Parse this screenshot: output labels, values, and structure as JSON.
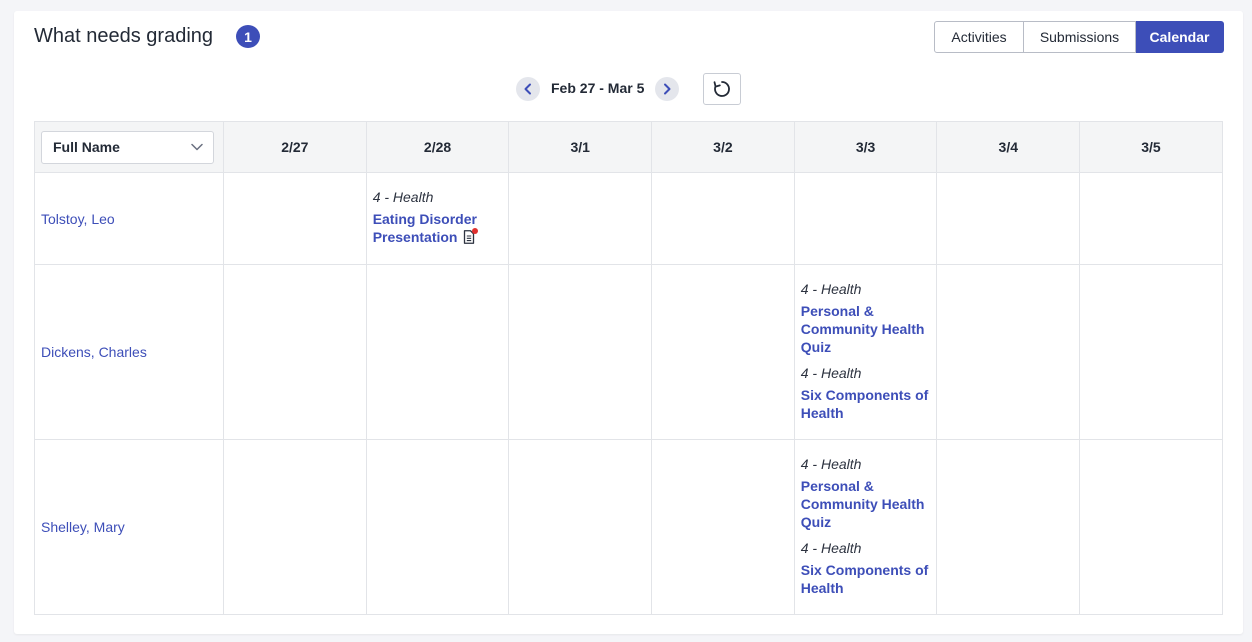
{
  "header": {
    "title": "What needs grading",
    "badge_count": "1"
  },
  "view_tabs": [
    {
      "label": "Activities",
      "active": false
    },
    {
      "label": "Submissions",
      "active": false
    },
    {
      "label": "Calendar",
      "active": true
    }
  ],
  "date_nav": {
    "range_label": "Feb 27 - Mar 5"
  },
  "table": {
    "sort_select_value": "Full Name",
    "dates": [
      "2/27",
      "2/28",
      "3/1",
      "3/2",
      "3/3",
      "3/4",
      "3/5"
    ],
    "rows": [
      {
        "student": "Tolstoy, Leo",
        "entries": [
          {
            "course": "4 - Health",
            "activity": "Eating Disorder Presentation",
            "has_new_submission": true
          }
        ]
      },
      {
        "student": "Dickens, Charles",
        "entries": [
          {
            "course": "4 - Health",
            "activity": "Personal & Community Health Quiz"
          },
          {
            "course": "4 - Health",
            "activity": "Six Components of Health"
          }
        ]
      },
      {
        "student": "Shelley, Mary",
        "entries": [
          {
            "course": "4 - Health",
            "activity": "Personal & Community Health Quiz"
          },
          {
            "course": "4 - Health",
            "activity": "Six Components of Health"
          }
        ]
      }
    ]
  },
  "colors": {
    "accent": "#3d4eb8",
    "notification_dot": "#e0302f"
  }
}
